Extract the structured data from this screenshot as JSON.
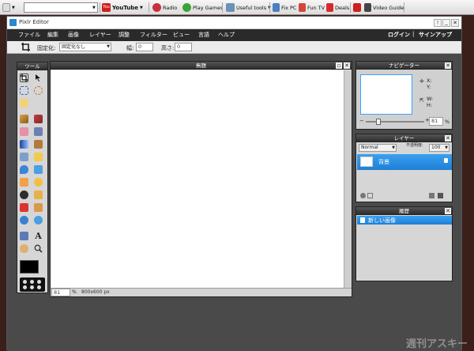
{
  "browser_toolbar": {
    "youtube_label": "YouTube",
    "radio_label": "Radio",
    "play_games_label": "Play Games",
    "useful_tools_label": "Useful tools",
    "fix_pc_label": "Fix PC",
    "fun_tv_label": "Fun TV",
    "deals_label": "Deals",
    "video_guide_label": "Video Guide"
  },
  "app": {
    "title": "Pixlr Editor",
    "menu": [
      "ファイル",
      "編集",
      "画像",
      "レイヤー",
      "調整",
      "フィルター",
      "ビュー",
      "言語",
      "ヘルプ"
    ],
    "login_label": "ログイン",
    "separator": "|",
    "signup_label": "サインアップ"
  },
  "options_bar": {
    "fixed_label": "固定化:",
    "fixed_value": "固定化なし",
    "width_label": "幅:",
    "width_value": "0",
    "height_label": "高さ:",
    "height_value": "0"
  },
  "tools_panel": {
    "title": "ツール"
  },
  "document": {
    "title": "無題",
    "zoom_value": "81",
    "zoom_unit": "%",
    "dimensions": "800x600 px"
  },
  "navigator": {
    "title": "ナビゲーター",
    "x_label": "X:",
    "y_label": "Y:",
    "w_label": "W:",
    "h_label": "H:",
    "zoom_value": "81",
    "zoom_unit": "%"
  },
  "layers": {
    "title": "レイヤー",
    "blend_mode": "Normal",
    "opacity_label": "不透明度:",
    "opacity_value": "100",
    "layer_name": "背景"
  },
  "history": {
    "title": "履歴",
    "entry": "新しい画像"
  },
  "watermark": "週刊アスキー"
}
